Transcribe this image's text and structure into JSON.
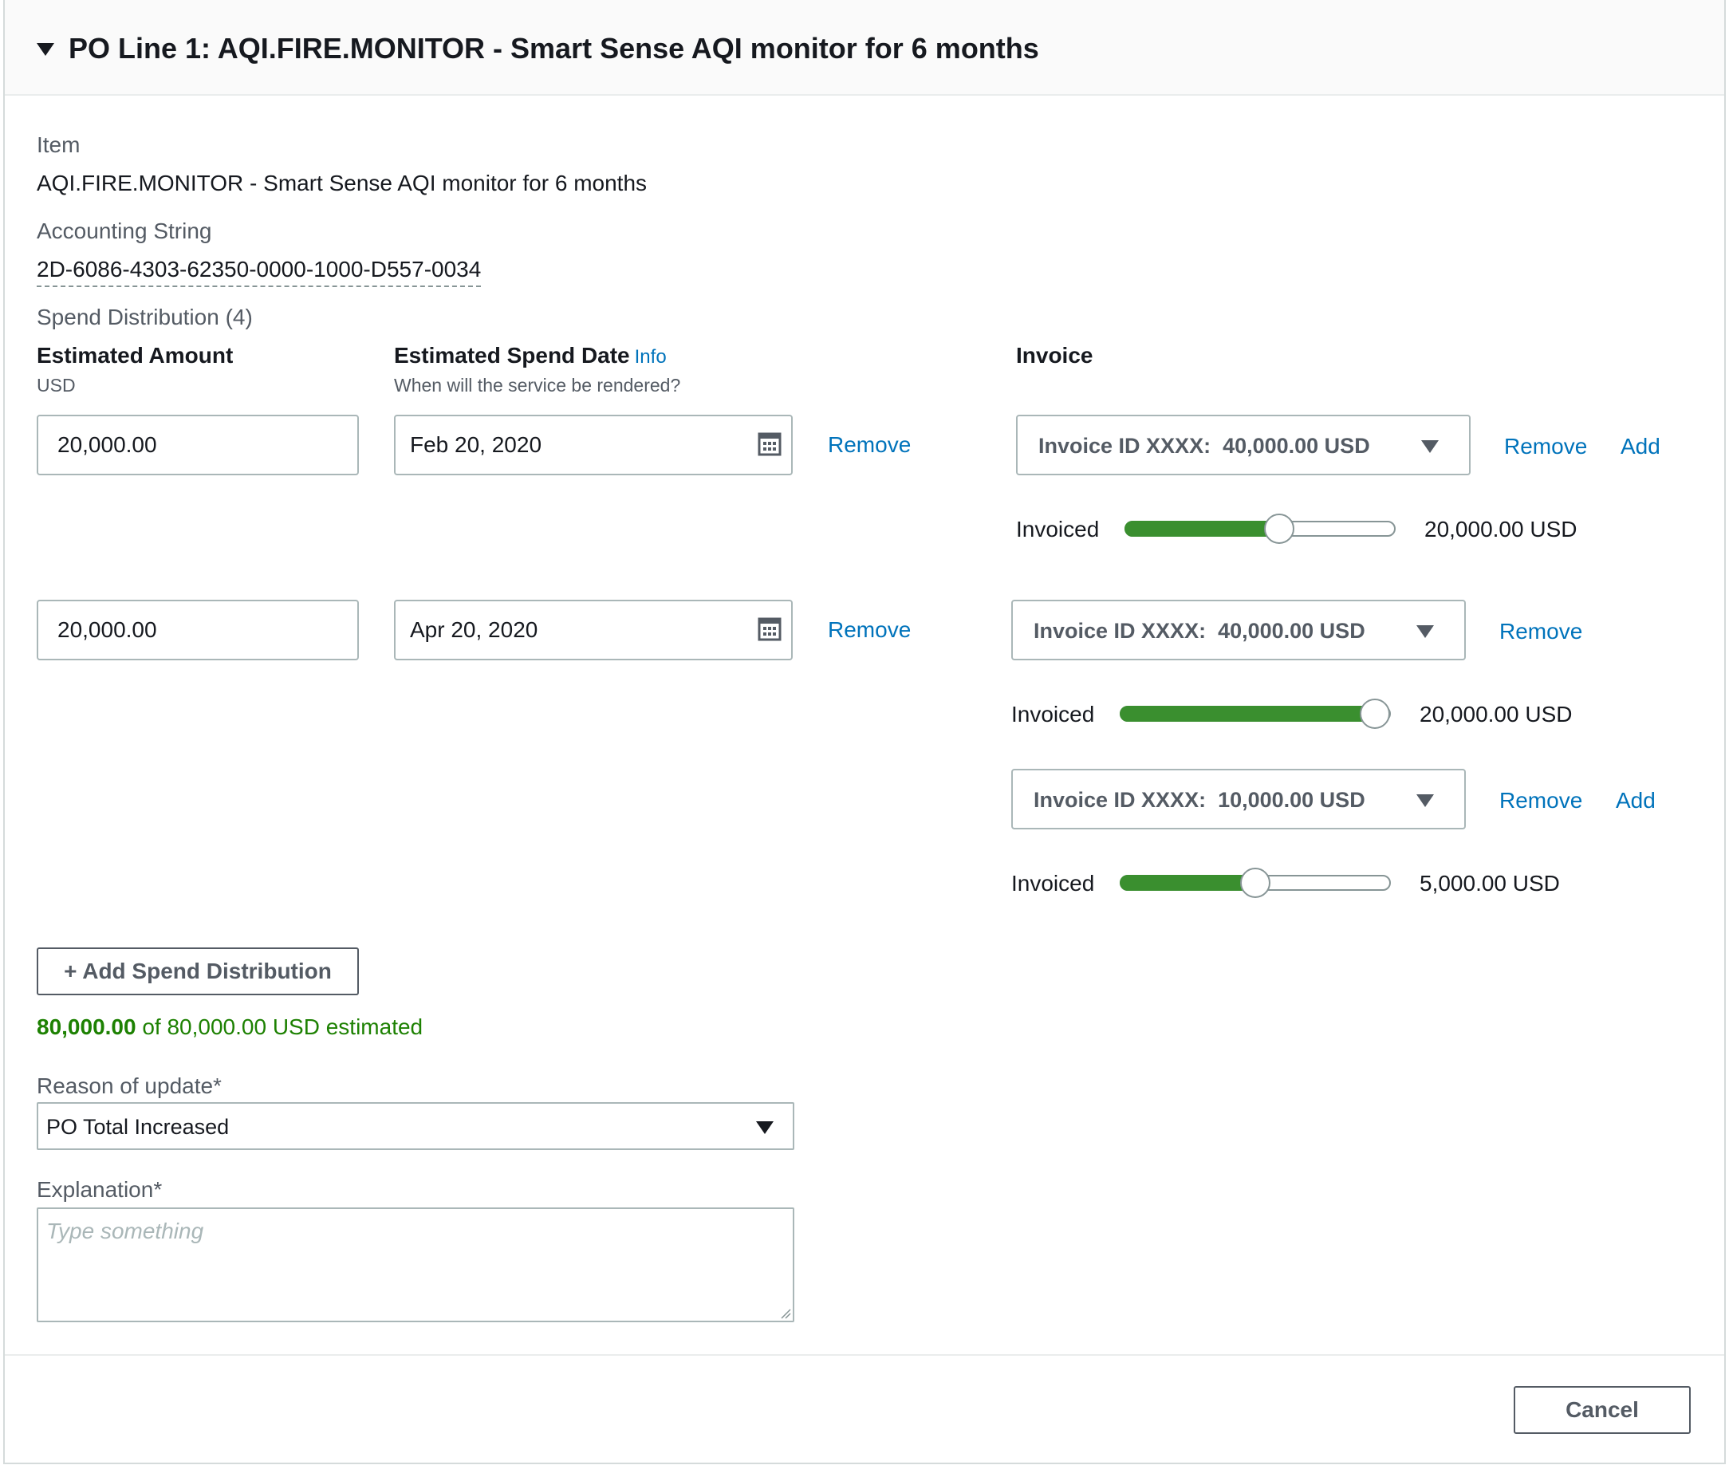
{
  "header": {
    "title": "PO Line 1: AQI.FIRE.MONITOR - Smart Sense AQI monitor for 6 months"
  },
  "item": {
    "label": "Item",
    "value": "AQI.FIRE.MONITOR - Smart Sense AQI monitor for 6 months"
  },
  "accounting": {
    "label": "Accounting String",
    "value": "2D-6086-4303-62350-0000-1000-D557-0034"
  },
  "spend_distribution": {
    "label": "Spend Distribution (4)",
    "col_amount": {
      "label": "Estimated Amount",
      "sub": "USD"
    },
    "col_date": {
      "label": "Estimated Spend Date",
      "info": "Info",
      "sub": "When will the service be rendered?"
    },
    "col_invoice": {
      "label": "Invoice"
    },
    "rows": [
      {
        "amount": "20,000.00",
        "date": "Feb 20, 2020",
        "remove": "Remove"
      },
      {
        "amount": "20,000.00",
        "date": "Apr 20, 2020",
        "remove": "Remove"
      }
    ],
    "invoices": [
      {
        "select": "Invoice ID XXXX:  40,000.00 USD",
        "remove": "Remove",
        "add": "Add",
        "invoiced_label": "Invoiced",
        "invoiced_value": "20,000.00 USD",
        "fraction": 0.57
      },
      {
        "select": "Invoice ID XXXX:  40,000.00 USD",
        "remove": "Remove",
        "invoiced_label": "Invoiced",
        "invoiced_value": "20,000.00 USD",
        "fraction": 0.94
      },
      {
        "select": "Invoice ID XXXX:  10,000.00 USD",
        "remove": "Remove",
        "add": "Add",
        "invoiced_label": "Invoiced",
        "invoiced_value": "5,000.00 USD",
        "fraction": 0.5
      }
    ],
    "add_button": "+ Add Spend Distribution",
    "total_bold": "80,000.00",
    "total_rest": " of 80,000.00 USD estimated"
  },
  "reason": {
    "label": "Reason of update*",
    "value": "PO Total Increased"
  },
  "explanation": {
    "label": "Explanation*",
    "placeholder": "Type something"
  },
  "footer": {
    "cancel": "Cancel"
  },
  "colors": {
    "accent_link": "#0073bb",
    "slider_fill": "#3a8f2f",
    "success_text": "#1d8102"
  }
}
